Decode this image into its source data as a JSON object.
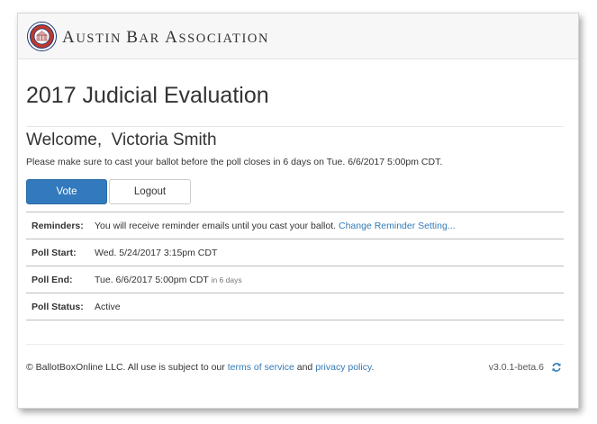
{
  "header": {
    "org_name_first": "A",
    "org_name_rest_1": "ustin ",
    "org_name_b": "B",
    "org_name_rest_2": "ar ",
    "org_name_a2": "A",
    "org_name_rest_3": "ssociation",
    "logo_icon": "association-seal-icon"
  },
  "page": {
    "title": "2017 Judicial Evaluation",
    "welcome": "Welcome,  Victoria Smith",
    "notice": "Please make sure to cast your ballot before the poll closes in 6 days on Tue. 6/6/2017 5:00pm CDT."
  },
  "buttons": {
    "vote": "Vote",
    "logout": "Logout"
  },
  "info": {
    "reminders_label": "Reminders:",
    "reminders_text": "You will receive reminder emails until you cast your ballot.",
    "reminders_link": "Change Reminder Setting...",
    "poll_start_label": "Poll Start:",
    "poll_start_value": "Wed. 5/24/2017 3:15pm CDT",
    "poll_end_label": "Poll End:",
    "poll_end_value": "Tue. 6/6/2017 5:00pm CDT",
    "poll_end_relative": "in 6 days",
    "poll_status_label": "Poll Status:",
    "poll_status_value": "Active"
  },
  "footer": {
    "copyright": "© BallotBoxOnline LLC. All use is subject to our",
    "terms_link": "terms of service",
    "and": "and",
    "privacy_link": "privacy policy",
    "period": ".",
    "version": "v3.0.1-beta.6",
    "refresh_icon": "refresh-icon"
  },
  "colors": {
    "primary": "#3379bd",
    "link": "#337ab7",
    "seal": "#c0392b"
  }
}
